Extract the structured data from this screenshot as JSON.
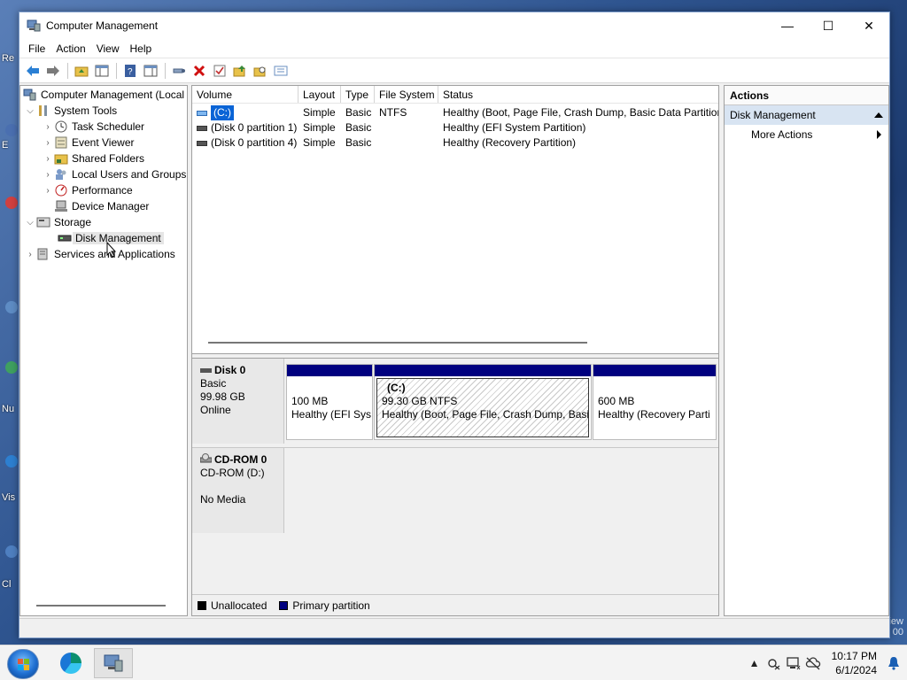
{
  "desktop": {
    "labels": [
      "Re",
      "E",
      "Nu",
      "Vis",
      "Cl"
    ],
    "watermark": [
      "iew",
      "00"
    ]
  },
  "window": {
    "title": "Computer Management",
    "controls": {
      "minimize": "—",
      "maximize": "☐",
      "close": "✕"
    }
  },
  "menu": [
    "File",
    "Action",
    "View",
    "Help"
  ],
  "tree": {
    "root": "Computer Management (Local",
    "items": [
      {
        "label": "System Tools",
        "level": 1,
        "expanded": true
      },
      {
        "label": "Task Scheduler",
        "level": 2,
        "expandable": true
      },
      {
        "label": "Event Viewer",
        "level": 2,
        "expandable": true
      },
      {
        "label": "Shared Folders",
        "level": 2,
        "expandable": true
      },
      {
        "label": "Local Users and Groups",
        "level": 2,
        "expandable": true
      },
      {
        "label": "Performance",
        "level": 2,
        "expandable": true
      },
      {
        "label": "Device Manager",
        "level": 2,
        "expandable": false
      },
      {
        "label": "Storage",
        "level": 1,
        "expanded": true
      },
      {
        "label": "Disk Management",
        "level": 2,
        "selected": true
      },
      {
        "label": "Services and Applications",
        "level": 1,
        "expandable": true
      }
    ]
  },
  "volumes": {
    "columns": [
      "Volume",
      "Layout",
      "Type",
      "File System",
      "Status"
    ],
    "rows": [
      {
        "volume": "(C:)",
        "layout": "Simple",
        "type": "Basic",
        "fs": "NTFS",
        "status": "Healthy (Boot, Page File, Crash Dump, Basic Data Partition)",
        "selected": true
      },
      {
        "volume": "(Disk 0 partition 1)",
        "layout": "Simple",
        "type": "Basic",
        "fs": "",
        "status": "Healthy (EFI System Partition)"
      },
      {
        "volume": "(Disk 0 partition 4)",
        "layout": "Simple",
        "type": "Basic",
        "fs": "",
        "status": "Healthy (Recovery Partition)"
      }
    ]
  },
  "disks": {
    "disk0": {
      "name": "Disk 0",
      "type": "Basic",
      "size": "99.98 GB",
      "state": "Online",
      "partitions": [
        {
          "name": "",
          "size": "100 MB",
          "status": "Healthy (EFI Sys"
        },
        {
          "name": "(C:)",
          "size": "99.30 GB NTFS",
          "status": "Healthy (Boot, Page File, Crash Dump, Basic",
          "selected": true
        },
        {
          "name": "",
          "size": "600 MB",
          "status": "Healthy (Recovery Parti"
        }
      ]
    },
    "cdrom0": {
      "name": "CD-ROM 0",
      "drive": "CD-ROM (D:)",
      "media": "No Media"
    }
  },
  "legend": [
    {
      "label": "Unallocated",
      "color": "#000000"
    },
    {
      "label": "Primary partition",
      "color": "#00007f"
    }
  ],
  "actions": {
    "header": "Actions",
    "section": "Disk Management",
    "items": [
      "More Actions"
    ]
  },
  "taskbar": {
    "time": "10:17 PM",
    "date": "6/1/2024"
  },
  "colors": {
    "selection": "#0a64d6",
    "primary_partition": "#00007f",
    "actions_section_bg": "#d8e4f2"
  }
}
